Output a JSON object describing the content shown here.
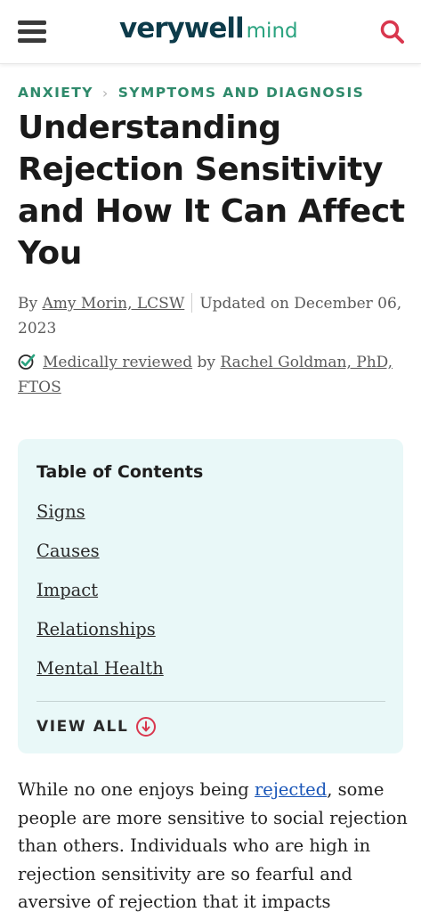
{
  "header": {
    "logo_main": "verywell",
    "logo_sub": "mind",
    "menu_icon": "hamburger-menu-icon",
    "search_icon": "search-icon",
    "search_color": "#d9374e"
  },
  "breadcrumb": {
    "items": [
      "ANXIETY",
      "SYMPTOMS AND DIAGNOSIS"
    ],
    "separator_icon": "chevron-right-icon"
  },
  "article": {
    "title": "Understanding Rejection Sensitivity and How It Can Affect You",
    "by_prefix": "By",
    "author": "Amy Morin, LCSW",
    "updated": "Updated on December 06, 2023",
    "reviewed_link": "Medically reviewed",
    "reviewed_by": "by",
    "reviewer": "Rachel Goldman, PhD, FTOS",
    "reviewed_icon": "check-shield-icon",
    "body_before_link": "While no one enjoys being ",
    "body_link": "rejected",
    "body_after_link": ", some people are more sensitive to social rejection than others. Individuals who are high in rejection sensitivity are so fearful and aversive of rejection that it impacts"
  },
  "toc": {
    "title": "Table of Contents",
    "links": [
      "Signs",
      "Causes",
      "Impact",
      "Relationships",
      "Mental Health"
    ],
    "view_all": "VIEW ALL",
    "view_all_icon": "arrow-down-circle-icon",
    "background": "#e9f8f8"
  },
  "colors": {
    "brand_dark": "#0d3b4a",
    "brand_green": "#2aa37f",
    "breadcrumb": "#2f8a6b",
    "link_blue": "#1a56b8",
    "accent_red": "#d9374e"
  }
}
